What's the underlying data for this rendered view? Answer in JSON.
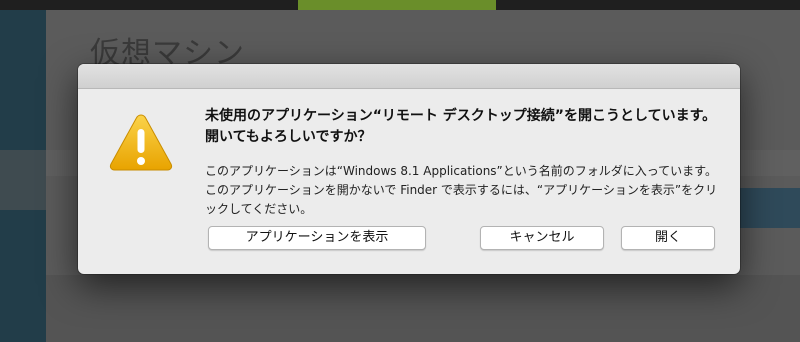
{
  "background": {
    "title": "仮想マシン"
  },
  "dialog": {
    "icon": "warning-triangle-icon",
    "title": "未使用のアプリケーション“リモート デスクトップ接続”を開こうとしています。開いてもよろしいですか？",
    "message": "このアプリケーションは“Windows 8.1 Applications”という名前のフォルダに入っています。このアプリケーションを開かないで Finder で表示するには、“アプリケーションを表示”をクリックしてください。",
    "buttons": {
      "show_app": "アプリケーションを表示",
      "cancel": "キャンセル",
      "open": "開く"
    }
  },
  "colors": {
    "warning": "#f2b600",
    "dialog_bg": "#ececec",
    "overlay": "#3b3b3b"
  }
}
